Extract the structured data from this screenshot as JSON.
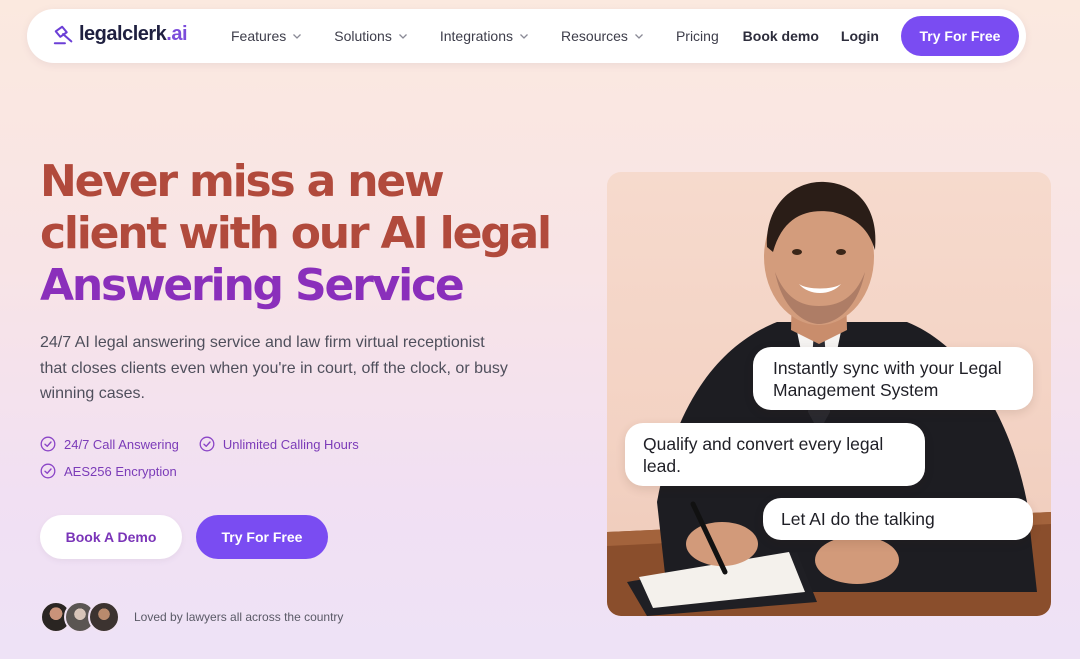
{
  "nav": {
    "logo_main": "legalclerk",
    "logo_tld": ".ai",
    "links": [
      {
        "label": "Features",
        "dropdown": true
      },
      {
        "label": "Solutions",
        "dropdown": true
      },
      {
        "label": "Integrations",
        "dropdown": true
      },
      {
        "label": "Resources",
        "dropdown": true
      },
      {
        "label": "Pricing",
        "dropdown": false
      }
    ],
    "book_demo": "Book demo",
    "login": "Login",
    "cta": "Try For Free"
  },
  "hero": {
    "headline_line1": "Never miss a new",
    "headline_line2": "client with our AI legal",
    "headline_line3": "Answering Service",
    "subtext": "24/7 AI legal answering service and law firm virtual receptionist that closes clients even when you're in court, off the clock, or busy winning cases.",
    "features": [
      "24/7 Call Answering",
      "Unlimited Calling Hours",
      "AES256 Encryption"
    ],
    "demo_button": "Book A Demo",
    "free_button": "Try For Free",
    "social_proof": "Loved by lawyers all across the country"
  },
  "bubbles": [
    "Instantly sync with your Legal Management System",
    "Qualify and convert every legal lead.",
    "Let AI do the talking"
  ],
  "colors": {
    "accent": "#7a4cf2",
    "headline": "#b14a3c",
    "headline_accent": "#8a2fbb"
  }
}
